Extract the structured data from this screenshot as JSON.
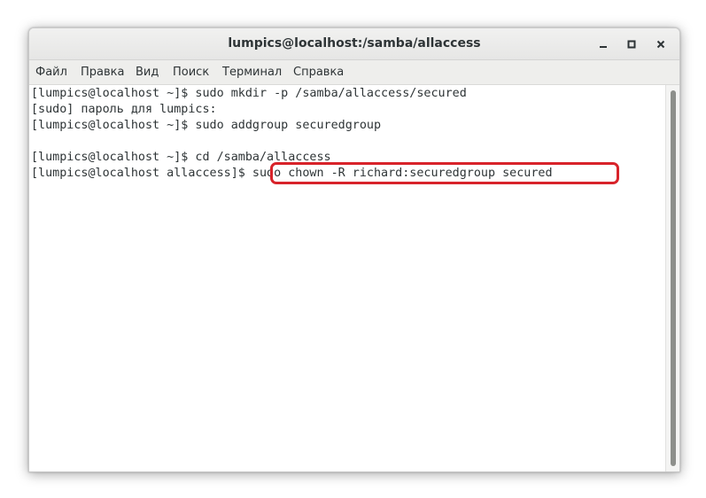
{
  "window": {
    "title": "lumpics@localhost:/samba/allaccess",
    "buttons": {
      "minimize": "–",
      "maximize": "□",
      "close": "×"
    }
  },
  "menu": {
    "items": [
      "Файл",
      "Правка",
      "Вид",
      "Поиск",
      "Терминал",
      "Справка"
    ]
  },
  "terminal": {
    "lines": [
      "[lumpics@localhost ~]$ sudo mkdir -p /samba/allaccess/secured",
      "[sudo] пароль для lumpics:",
      "[lumpics@localhost ~]$ sudo addgroup securedgroup",
      "",
      "[lumpics@localhost ~]$ cd /samba/allaccess",
      "[lumpics@localhost allaccess]$ sudo chown -R richard:securedgroup secured"
    ],
    "highlighted_command": "sudo chown -R richard:securedgroup secured",
    "highlight_color": "#d8232a",
    "text_color": "#2e3436",
    "background_color": "#ffffff"
  }
}
